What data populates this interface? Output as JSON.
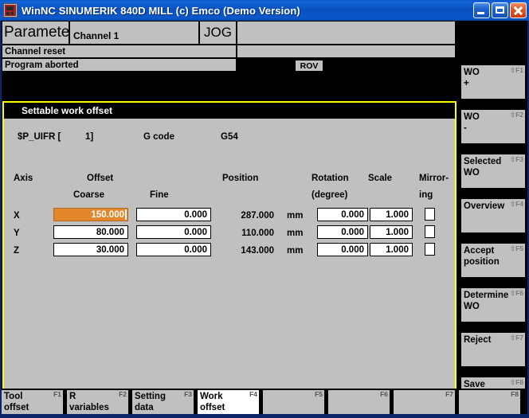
{
  "window": {
    "title": "WinNC SINUMERIK 840D MILL (c) Emco (Demo Version)",
    "icon": "app-machine-icon",
    "minimize_label": "Minimize",
    "maximize_label": "Maximize",
    "close_label": "Close",
    "titlebar_color": "#0a50bd"
  },
  "header": {
    "area": "Parameter",
    "channel": "Channel 1",
    "mode": "JOG",
    "status1": "Channel reset",
    "status2": "Program aborted",
    "rov": "ROV"
  },
  "panel": {
    "title": "Settable work offset",
    "border_color": "#ffff00",
    "param_name": "$P_UIFR [",
    "param_index": "1]",
    "gcode_label": "G code",
    "gcode_value": "G54",
    "columns": {
      "axis": "Axis",
      "offset": "Offset",
      "coarse": "Coarse",
      "fine": "Fine",
      "position": "Position",
      "rotation": "Rotation",
      "rotation_unit": "(degree)",
      "scale": "Scale",
      "mirroring1": "Mirror-",
      "mirroring2": "ing"
    },
    "rows": [
      {
        "axis": "X",
        "coarse": "150.000",
        "fine": "0.000",
        "position": "287.000",
        "unit": "mm",
        "rotation": "0.000",
        "scale": "1.000",
        "mirroring": false,
        "selected": true
      },
      {
        "axis": "Y",
        "coarse": "80.000",
        "fine": "0.000",
        "position": "110.000",
        "unit": "mm",
        "rotation": "0.000",
        "scale": "1.000",
        "mirroring": false,
        "selected": false
      },
      {
        "axis": "Z",
        "coarse": "30.000",
        "fine": "0.000",
        "position": "143.000",
        "unit": "mm",
        "rotation": "0.000",
        "scale": "1.000",
        "mirroring": false,
        "selected": false
      }
    ],
    "selection_color": "#e3872c"
  },
  "vertical_softkeys": [
    {
      "line1": "WO",
      "line2": "+",
      "fn": "⇧F1"
    },
    {
      "line1": "WO",
      "line2": "-",
      "fn": "⇧F2"
    },
    {
      "line1": "Selected",
      "line2": "WO",
      "fn": "⇧F3"
    },
    {
      "line1": "Overview",
      "line2": "",
      "fn": "⇧F4"
    },
    {
      "line1": "Accept",
      "line2": "position",
      "fn": "⇧F5"
    },
    {
      "line1": "Determine",
      "line2": "WO",
      "fn": "⇧F6"
    },
    {
      "line1": "Reject",
      "line2": "",
      "fn": "⇧F7"
    },
    {
      "line1": "Save",
      "line2": "",
      "fn": "⇧F8"
    }
  ],
  "horizontal_softkeys": [
    {
      "line1": "Tool",
      "line2": "offset",
      "fn": "F1",
      "active": false
    },
    {
      "line1": "R",
      "line2": "variables",
      "fn": "F2",
      "active": false
    },
    {
      "line1": "Setting",
      "line2": "data",
      "fn": "F3",
      "active": false
    },
    {
      "line1": "Work",
      "line2": "offset",
      "fn": "F4",
      "active": true
    },
    {
      "line1": "",
      "line2": "",
      "fn": "F5",
      "active": false
    },
    {
      "line1": "",
      "line2": "",
      "fn": "F6",
      "active": false
    },
    {
      "line1": "",
      "line2": "",
      "fn": "F7",
      "active": false
    },
    {
      "line1": "",
      "line2": "",
      "fn": "F8",
      "active": false
    }
  ]
}
